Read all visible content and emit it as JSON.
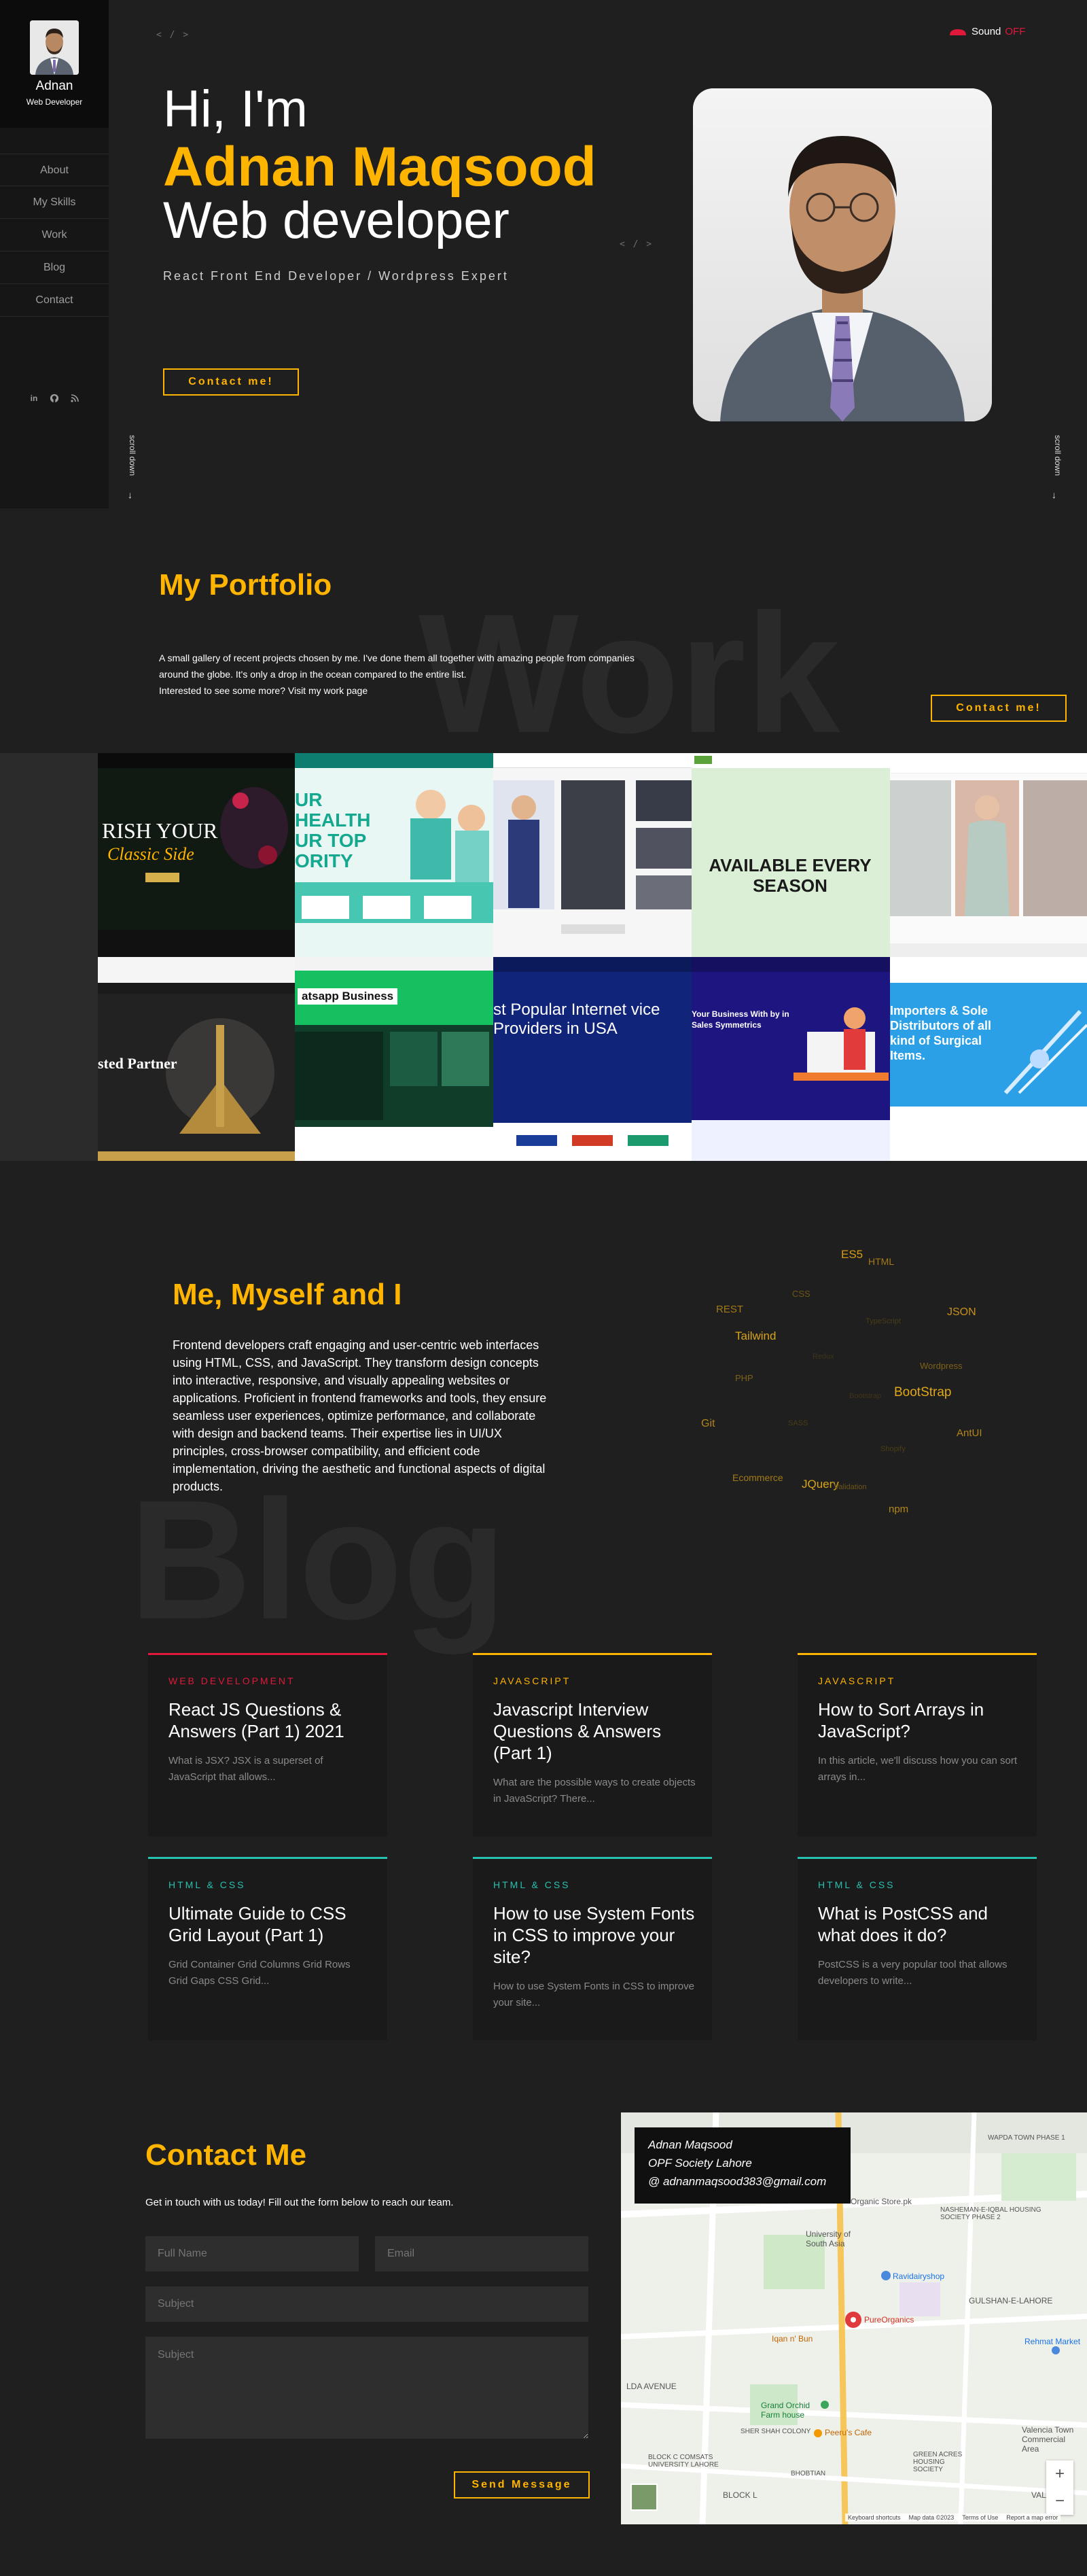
{
  "sidebar": {
    "name": "Adnan",
    "role": "Web Developer",
    "nav": [
      "About",
      "My Skills",
      "Work",
      "Blog",
      "Contact"
    ],
    "social_icons": [
      "linkedin-icon",
      "github-icon",
      "rss-icon"
    ],
    "scroll_left": "scroll down",
    "scroll_right": "scroll down"
  },
  "hero": {
    "code_tag": "< / >",
    "code_tag_2": "< / >",
    "greeting": "Hi, I'm",
    "name": "Adnan Maqsood",
    "role": "Web developer",
    "subtitle": "React Front End Developer / Wordpress Expert",
    "cta": "Contact me!",
    "sound_label": "Sound",
    "sound_state": "OFF"
  },
  "portfolio": {
    "bg_word": "Work",
    "title": "My Portfolio",
    "desc_line1": "A small gallery of recent projects chosen by me. I've done them all together with amazing people from companies",
    "desc_line2": "around the globe. It's only a drop in the ocean compared to the entire list.",
    "desc_line3": "Interested to see some more? Visit my work page",
    "cta": "Contact me!",
    "tiles": [
      {
        "title": "RISH YOUR",
        "sub": "Classic Side"
      },
      {
        "title": "UR HEALTH UR TOP ORITY"
      },
      {
        "title": ""
      },
      {
        "title": "AVAILABLE EVERY SEASON"
      },
      {
        "title": ""
      },
      {
        "title": "sted Partner"
      },
      {
        "title": "atsapp Business"
      },
      {
        "title": "st Popular Internet vice Providers in USA"
      },
      {
        "title": "Your Business With by in Sales Symmetrics"
      },
      {
        "title": "Importers & Sole Distributors of all kind of Surgical Items."
      }
    ]
  },
  "about": {
    "bg_word": "Blog",
    "title": "Me, Myself and I",
    "text": "Frontend developers craft engaging and user-centric web interfaces using HTML, CSS, and JavaScript. They transform design concepts into interactive, responsive, and visually appealing websites or applications. Proficient in frontend frameworks and tools, they ensure seamless user experiences, optimize performance, and collaborate with design and backend teams. Their expertise lies in UI/UX principles, cross-browser compatibility, and efficient code implementation, driving the aesthetic and functional aspects of digital products.",
    "tags": [
      "ES5",
      "HTML",
      "CSS",
      "REST",
      "TypeScript",
      "JSON",
      "Tailwind",
      "Redux",
      "Wordpress",
      "PHP",
      "Bootstrap",
      "BootStrap",
      "Git",
      "SASS",
      "AntUI",
      "Shopify",
      "Ecommerce",
      "JQuery",
      "Validation",
      "npm"
    ]
  },
  "blog": {
    "cards": [
      {
        "category": "WEB DEVELOPMENT",
        "title": "React JS Questions & Answers (Part 1) 2021",
        "excerpt": "What is JSX? JSX is a superset of JavaScript that allows...",
        "color": "#e0193b"
      },
      {
        "category": "JAVASCRIPT",
        "title": "Javascript Interview Questions & Answers (Part 1)",
        "excerpt": "What are the possible ways to create objects in JavaScript? There...",
        "color": "#ffb400"
      },
      {
        "category": "JAVASCRIPT",
        "title": "How to Sort Arrays in JavaScript?",
        "excerpt": "In this article, we'll discuss how you can sort arrays in...",
        "color": "#ffb400"
      },
      {
        "category": "HTML & CSS",
        "title": "Ultimate Guide to CSS Grid Layout (Part 1)",
        "excerpt": "Grid Container Grid Columns Grid Rows Grid Gaps   CSS Grid...",
        "color": "#27c1b0"
      },
      {
        "category": "HTML & CSS",
        "title": "How to use System Fonts in CSS to improve your site?",
        "excerpt": "How to use System Fonts in CSS to improve your site...",
        "color": "#27c1b0"
      },
      {
        "category": "HTML & CSS",
        "title": "What is PostCSS and what does it do?",
        "excerpt": "PostCSS is a very popular tool that allows developers to write...",
        "color": "#27c1b0"
      }
    ]
  },
  "contact": {
    "title": "Contact Me",
    "intro": "Get in touch with us today! Fill out the form below to reach our team.",
    "full_name_placeholder": "Full Name",
    "email_placeholder": "Email",
    "subject_placeholder": "Subject",
    "message_placeholder": "Subject",
    "send_label": "Send Message",
    "map_card": {
      "name": "Adnan Maqsood",
      "address": "OPF Society Lahore",
      "email": "@ adnanmaqsood383@gmail.com"
    },
    "map_labels": [
      "Organic Store.pk",
      "University of South Asia",
      "Ravidairyshop",
      "PureOrganics",
      "Iqan n' Bun",
      "Grand Orchid Farm house",
      "Peeru's Cafe",
      "Rehmat Market",
      "Valencia Town Commercial Area",
      "GULSHAN-E-LAHORE",
      "NASHEMAN-E-IQBAL HOUSING SOCIETY PHASE 2",
      "WAPDA TOWN PHASE 1",
      "LDA AVENUE",
      "SHER SHAH COLONY",
      "GREEN ACRES HOUSING SOCIETY",
      "BLOCK C COMSATS UNIVERSITY LAHORE",
      "BHOBTIAN",
      "BLOCK L",
      "VALENCIA"
    ],
    "map_footer": [
      "Keyboard shortcuts",
      "Map data ©2023",
      "Terms of Use",
      "Report a map error"
    ],
    "zoom_in": "+",
    "zoom_out": "−"
  },
  "colors": {
    "accent": "#ffb400",
    "red": "#e0193b",
    "teal": "#27c1b0",
    "bg": "#1f1f1f"
  }
}
